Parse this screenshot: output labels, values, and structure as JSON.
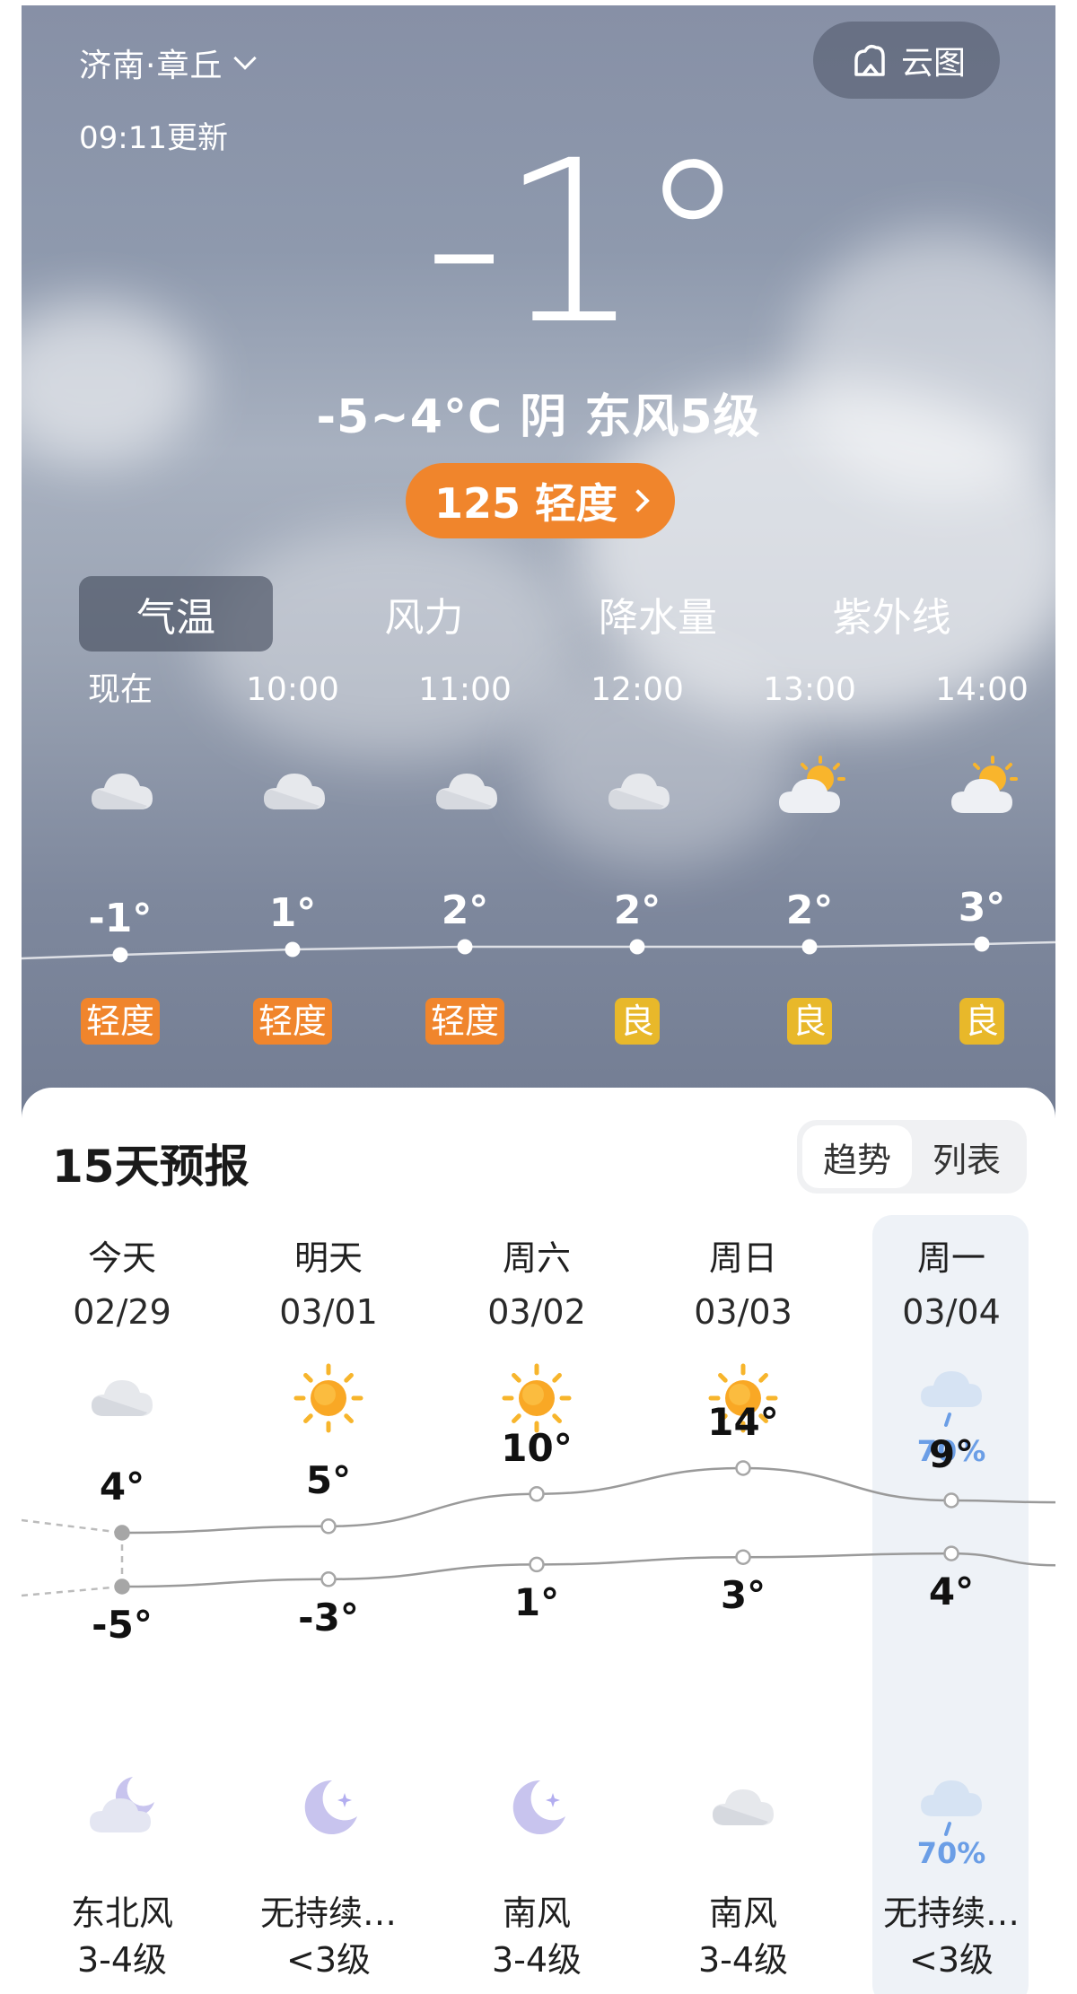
{
  "header": {
    "location": "济南·章丘",
    "update_time": "09:11更新",
    "cloud_map_label": "云图",
    "current_temp": "-1°",
    "summary": "-5~4°C 阴 东风5级",
    "aqi_label": "125 轻度"
  },
  "tabs": [
    {
      "label": "气温",
      "active": true
    },
    {
      "label": "风力",
      "active": false
    },
    {
      "label": "降水量",
      "active": false
    },
    {
      "label": "紫外线",
      "active": false
    }
  ],
  "hourly": [
    {
      "time": "现在",
      "icon": "cloudy-icon",
      "temp": "-1°",
      "temp_value": -1,
      "aqi": "轻度",
      "aqi_color": "#f0852c"
    },
    {
      "time": "10:00",
      "icon": "cloudy-icon",
      "temp": "1°",
      "temp_value": 1,
      "aqi": "轻度",
      "aqi_color": "#f0852c"
    },
    {
      "time": "11:00",
      "icon": "cloudy-icon",
      "temp": "2°",
      "temp_value": 2,
      "aqi": "轻度",
      "aqi_color": "#f0852c"
    },
    {
      "time": "12:00",
      "icon": "cloudy-icon",
      "temp": "2°",
      "temp_value": 2,
      "aqi": "良",
      "aqi_color": "#e8b82a"
    },
    {
      "time": "13:00",
      "icon": "partly-sunny-icon",
      "temp": "2°",
      "temp_value": 2,
      "aqi": "良",
      "aqi_color": "#e8b82a"
    },
    {
      "time": "14:00",
      "icon": "partly-sunny-icon",
      "temp": "3°",
      "temp_value": 3,
      "aqi": "良",
      "aqi_color": "#e8b82a"
    }
  ],
  "forecast": {
    "title": "15天预报",
    "toggle": [
      {
        "label": "趋势",
        "active": true
      },
      {
        "label": "列表",
        "active": false
      }
    ],
    "days": [
      {
        "name": "今天",
        "date": "02/29",
        "day_icon": "cloudy-icon",
        "day_prob": "",
        "high": "4°",
        "high_value": 4,
        "low": "-5°",
        "low_value": -5,
        "night_icon": "moon-cloud-icon",
        "night_prob": "",
        "wind_dir": "东北风",
        "wind_level": "3-4级"
      },
      {
        "name": "明天",
        "date": "03/01",
        "day_icon": "sun-icon",
        "day_prob": "",
        "high": "5°",
        "high_value": 5,
        "low": "-3°",
        "low_value": -3,
        "night_icon": "moon-icon",
        "night_prob": "",
        "wind_dir": "无持续…",
        "wind_level": "<3级"
      },
      {
        "name": "周六",
        "date": "03/02",
        "day_icon": "sun-icon",
        "day_prob": "",
        "high": "10°",
        "high_value": 10,
        "low": "1°",
        "low_value": 1,
        "night_icon": "moon-icon",
        "night_prob": "",
        "wind_dir": "南风",
        "wind_level": "3-4级"
      },
      {
        "name": "周日",
        "date": "03/03",
        "day_icon": "sun-icon",
        "day_prob": "",
        "high": "14°",
        "high_value": 14,
        "low": "3°",
        "low_value": 3,
        "night_icon": "cloudy-icon",
        "night_prob": "",
        "wind_dir": "南风",
        "wind_level": "3-4级"
      },
      {
        "name": "周一",
        "date": "03/04",
        "day_icon": "rain-icon",
        "day_prob": "70%",
        "high": "9°",
        "high_value": 9,
        "low": "4°",
        "low_value": 4,
        "night_icon": "rain-icon",
        "night_prob": "70%",
        "wind_dir": "无持续…",
        "wind_level": "<3级"
      }
    ]
  }
}
